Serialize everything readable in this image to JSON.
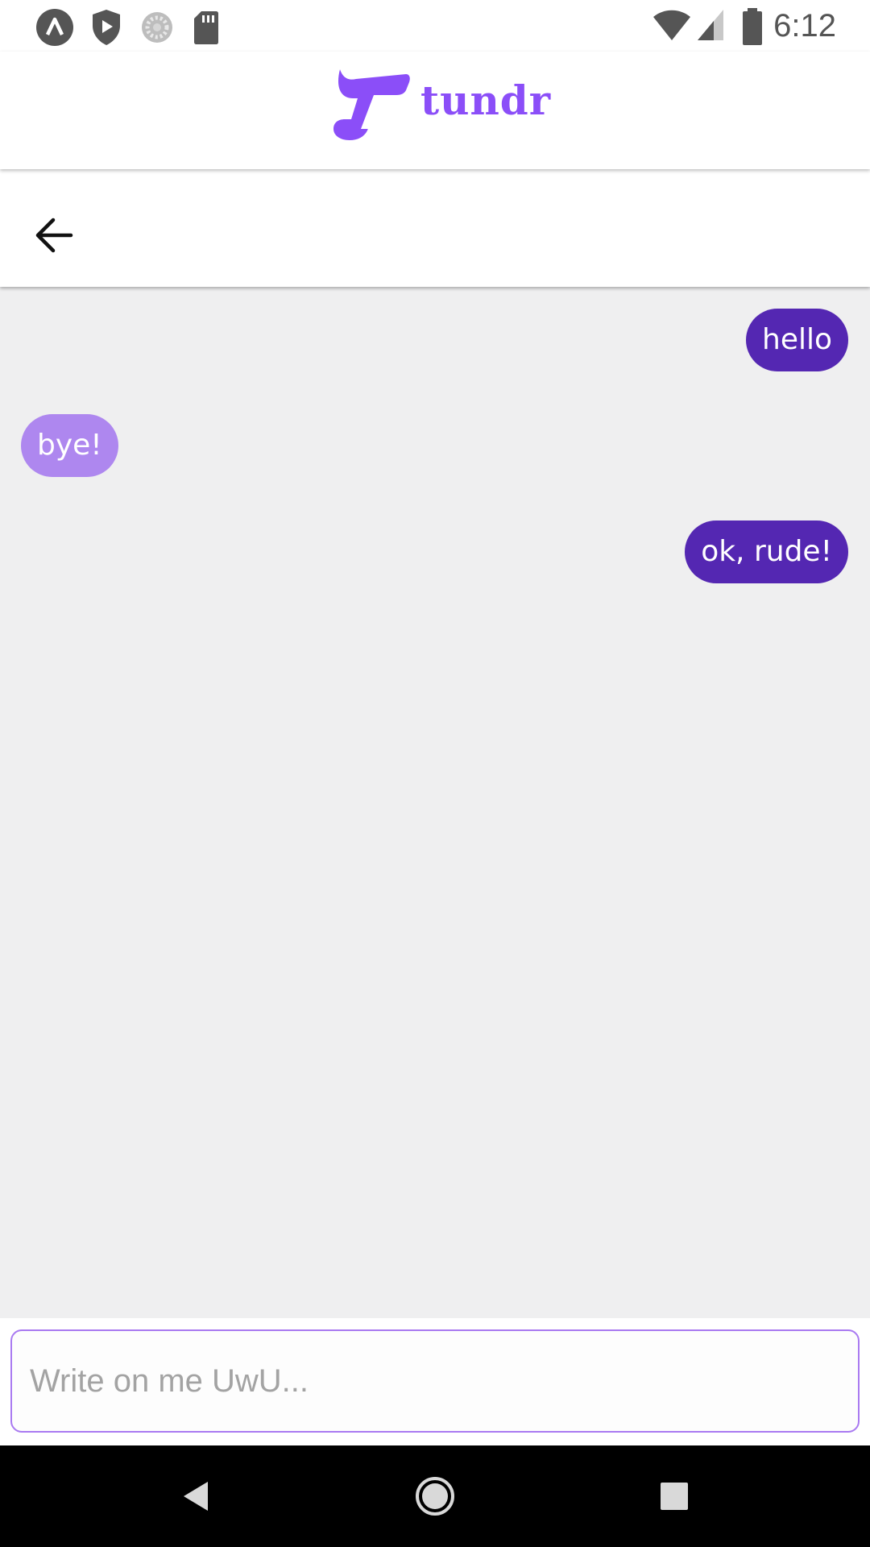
{
  "status_bar": {
    "time": "6:12",
    "left_icons": [
      "app-notification-icon",
      "shield-play-icon",
      "sync-spinner-icon",
      "sd-card-icon"
    ],
    "right_icons": [
      "wifi-icon",
      "cell-signal-icon",
      "battery-icon"
    ]
  },
  "brand": {
    "name": "tundr",
    "color": "#8b4ef8"
  },
  "chat": {
    "messages": [
      {
        "text": "hello",
        "direction": "sent"
      },
      {
        "text": "bye!",
        "direction": "received"
      },
      {
        "text": "ok, rude!",
        "direction": "sent"
      }
    ],
    "sent_color": "#5427b2",
    "received_color": "#ae87ef"
  },
  "compose": {
    "placeholder": "Write on me UwU...",
    "value": ""
  },
  "nav_bar": {
    "buttons": [
      "back-triangle-icon",
      "home-circle-icon",
      "recents-square-icon"
    ]
  }
}
